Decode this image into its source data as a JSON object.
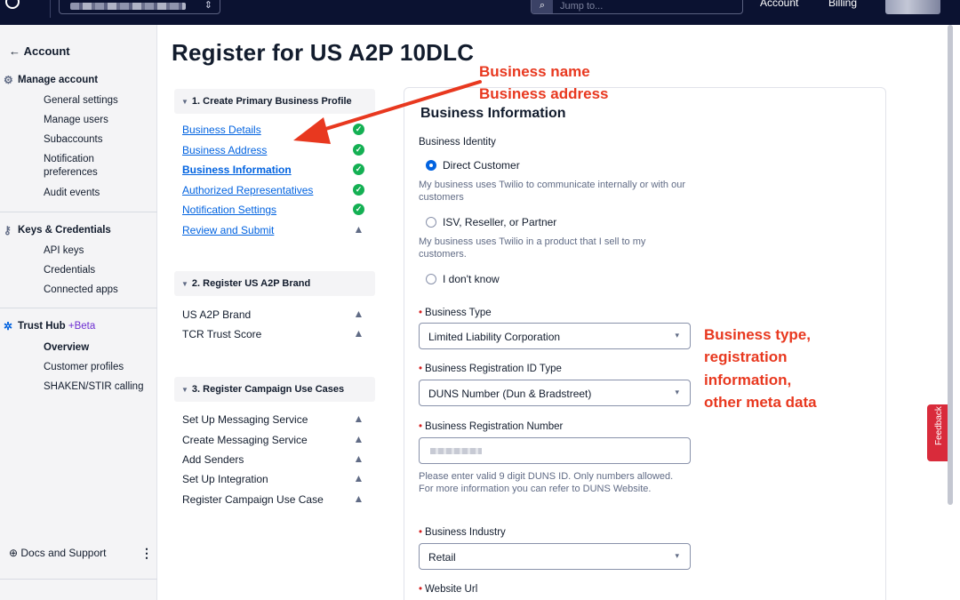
{
  "topbar": {
    "search_placeholder": "Jump to...",
    "nav": [
      "Account",
      "Billing"
    ]
  },
  "sidebar": {
    "back_label": "Account",
    "manage_account": {
      "title": "Manage account",
      "items": [
        "General settings",
        "Manage users",
        "Subaccounts",
        "Notification preferences",
        "Audit events"
      ]
    },
    "keys": {
      "title": "Keys & Credentials",
      "items": [
        "API keys",
        "Credentials",
        "Connected apps"
      ]
    },
    "trust_hub": {
      "title": "Trust Hub",
      "badge": "Beta",
      "items": [
        "Overview",
        "Customer profiles",
        "SHAKEN/STIR calling"
      ]
    },
    "docs_label": "Docs and Support"
  },
  "main": {
    "title": "Register for US A2P 10DLC",
    "steps": [
      {
        "header": "1. Create Primary Business Profile",
        "items": [
          {
            "label": "Business Details",
            "status": "complete"
          },
          {
            "label": "Business Address",
            "status": "complete"
          },
          {
            "label": "Business Information",
            "status": "complete"
          },
          {
            "label": "Authorized Representatives",
            "status": "complete"
          },
          {
            "label": "Notification Settings",
            "status": "complete"
          },
          {
            "label": "Review and Submit",
            "status": "warning"
          }
        ]
      },
      {
        "header": "2. Register US A2P Brand",
        "items": [
          {
            "label": "US A2P Brand",
            "status": "warning"
          },
          {
            "label": "TCR Trust Score",
            "status": "warning"
          }
        ]
      },
      {
        "header": "3. Register Campaign Use Cases",
        "items": [
          {
            "label": "Set Up Messaging Service",
            "status": "warning"
          },
          {
            "label": "Create Messaging Service",
            "status": "warning"
          },
          {
            "label": "Add Senders",
            "status": "warning"
          },
          {
            "label": "Set Up Integration",
            "status": "warning"
          },
          {
            "label": "Register Campaign Use Case",
            "status": "warning"
          }
        ]
      }
    ]
  },
  "form": {
    "title": "Business Information",
    "identity_label": "Business Identity",
    "identity_options": [
      {
        "label": "Direct Customer",
        "help": "My business uses Twilio to communicate internally or with our customers",
        "selected": true
      },
      {
        "label": "ISV, Reseller, or Partner",
        "help": "My business uses Twilio in a product that I sell to my customers.",
        "selected": false
      },
      {
        "label": "I don't know",
        "help": "",
        "selected": false
      }
    ],
    "business_type": {
      "label": "Business Type",
      "value": "Limited Liability Corporation"
    },
    "reg_id_type": {
      "label": "Business Registration ID Type",
      "value": "DUNS Number (Dun & Bradstreet)"
    },
    "reg_number": {
      "label": "Business Registration Number",
      "help": "Please enter valid 9 digit DUNS ID. Only numbers allowed. For more information you can refer to DUNS Website."
    },
    "industry": {
      "label": "Business Industry",
      "value": "Retail"
    },
    "website": {
      "label": "Website Url"
    }
  },
  "annotations": {
    "top_line1": "Business name",
    "top_line2": "Business address",
    "right_line1": "Business type,",
    "right_line2": "registration",
    "right_line3": "information,",
    "right_line4": "other meta data"
  },
  "feedback_label": "Feedback",
  "colors": {
    "topbar": "#0b1231",
    "link": "#0263e0",
    "success": "#14b053",
    "annotation": "#e8381f",
    "feedback": "#d92b3b"
  }
}
